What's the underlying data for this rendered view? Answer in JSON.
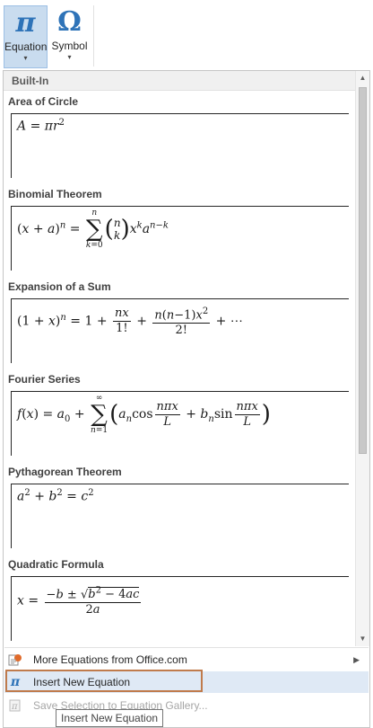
{
  "ribbon": {
    "equation": {
      "glyph": "π",
      "label": "Equation",
      "caret": "▾"
    },
    "symbol": {
      "glyph": "Ω",
      "label": "Symbol",
      "caret": "▾"
    }
  },
  "gallery": {
    "section_title": "Built-In",
    "items": [
      {
        "title": "Area of Circle"
      },
      {
        "title": "Binomial Theorem"
      },
      {
        "title": "Expansion of a Sum"
      },
      {
        "title": "Fourier Series"
      },
      {
        "title": "Pythagorean Theorem"
      },
      {
        "title": "Quadratic Formula"
      }
    ]
  },
  "commands": {
    "more": {
      "label": "More Equations from Office.com",
      "icon": "office-icon"
    },
    "insert": {
      "label": "Insert New Equation",
      "icon": "pi-icon",
      "glyph": "π"
    },
    "save": {
      "label": "Save Selection to Equation Gallery...",
      "icon": "save-gallery-icon"
    }
  },
  "tooltip": "Insert New Equation",
  "colors": {
    "accent": "#2e73b8",
    "selected_bg": "#c9dcef",
    "hover_bg": "#dfe9f5",
    "highlight_border": "#c07b4c"
  }
}
